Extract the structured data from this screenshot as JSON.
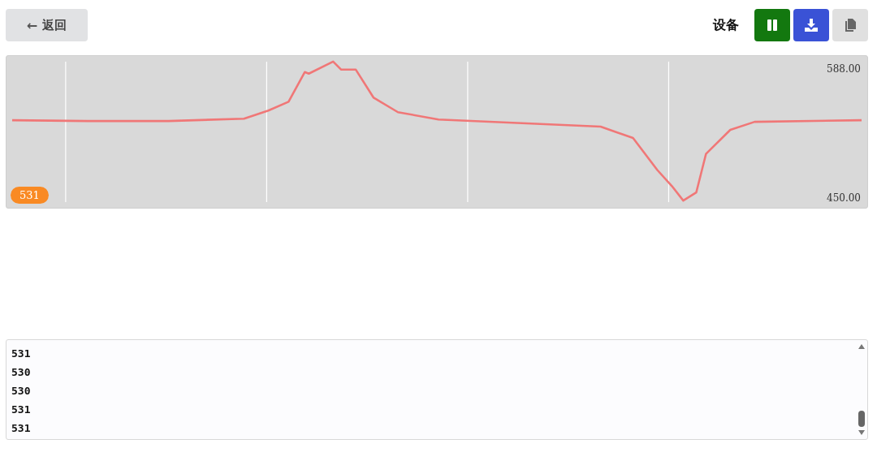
{
  "toolbar": {
    "back_button": {
      "icon": "←",
      "label": "返回"
    },
    "device_label": "设备",
    "actions": [
      {
        "kind": "pause",
        "color": "#13780f"
      },
      {
        "kind": "download",
        "color": "#3a52d6"
      },
      {
        "kind": "copy",
        "color": "#e0e0e0"
      }
    ]
  },
  "plot": {
    "max_label": "588.00",
    "min_label": "450.00",
    "current_badge": "531"
  },
  "log": {
    "lines": [
      "531",
      "530",
      "530",
      "531",
      "531"
    ]
  }
}
